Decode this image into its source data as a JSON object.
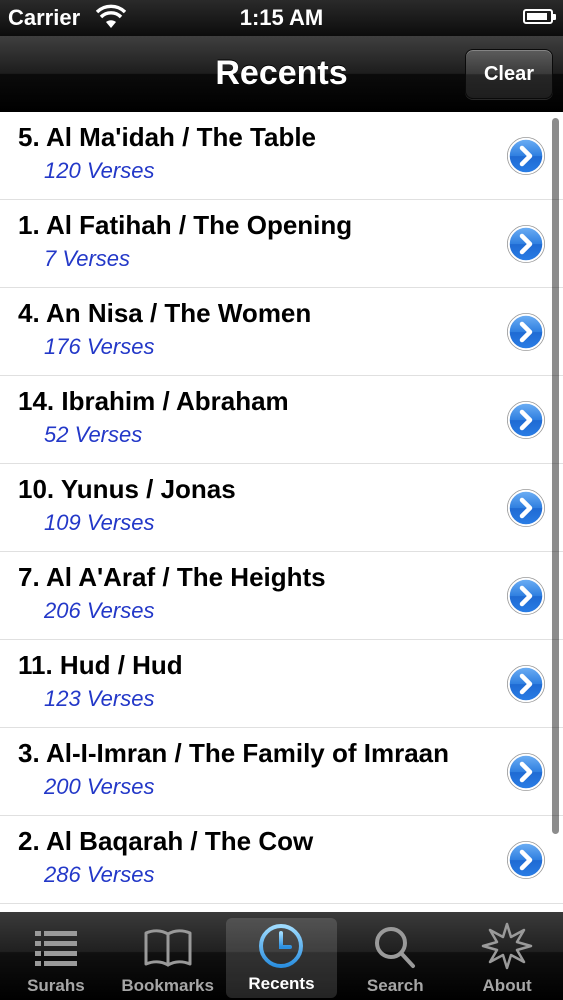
{
  "status_bar": {
    "carrier": "Carrier",
    "time": "1:15 AM",
    "battery_level": 0.9
  },
  "nav_bar": {
    "title": "Recents",
    "clear_label": "Clear"
  },
  "rows": [
    {
      "title": "5. Al Ma'idah / The Table",
      "subtitle": "120 Verses"
    },
    {
      "title": "1. Al Fatihah / The Opening",
      "subtitle": "7 Verses"
    },
    {
      "title": "4. An Nisa / The Women",
      "subtitle": "176 Verses"
    },
    {
      "title": "14. Ibrahim / Abraham",
      "subtitle": "52 Verses"
    },
    {
      "title": "10. Yunus / Jonas",
      "subtitle": "109 Verses"
    },
    {
      "title": "7. Al A'Araf / The Heights",
      "subtitle": "206 Verses"
    },
    {
      "title": "11. Hud / Hud",
      "subtitle": "123 Verses"
    },
    {
      "title": "3. Al-I-Imran / The Family of Imraan",
      "subtitle": "200 Verses"
    },
    {
      "title": "2. Al Baqarah / The Cow",
      "subtitle": "286 Verses"
    }
  ],
  "tabs": [
    {
      "label": "Surahs",
      "icon": "list-icon"
    },
    {
      "label": "Bookmarks",
      "icon": "book-icon"
    },
    {
      "label": "Recents",
      "icon": "clock-icon"
    },
    {
      "label": "Search",
      "icon": "magnifier-icon"
    },
    {
      "label": "About",
      "icon": "star-burst-icon"
    }
  ],
  "colors": {
    "accent": "#2338c8",
    "disclosure_blue": "#2a73d8"
  }
}
